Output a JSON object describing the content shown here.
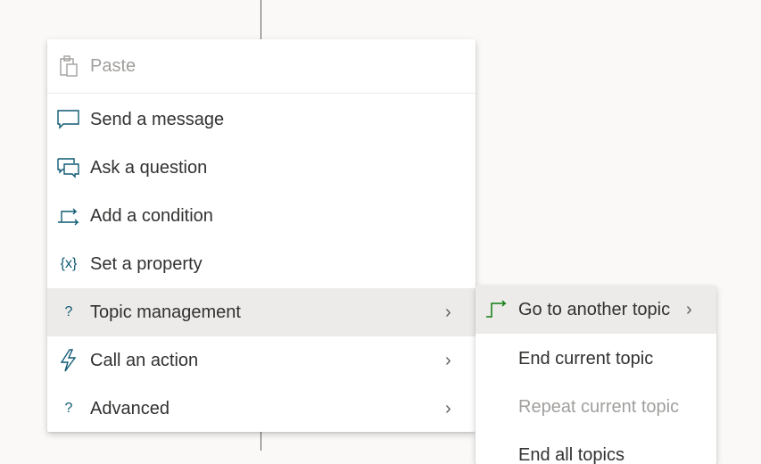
{
  "main_menu": {
    "paste": "Paste",
    "items": [
      {
        "label": "Send a message",
        "icon": "message-icon"
      },
      {
        "label": "Ask a question",
        "icon": "question-chat-icon"
      },
      {
        "label": "Add a condition",
        "icon": "condition-icon"
      },
      {
        "label": "Set a property",
        "icon": "variable-icon",
        "icon_text": "{x}"
      },
      {
        "label": "Topic management",
        "icon": "topic-icon",
        "icon_text": "?",
        "has_submenu": true
      },
      {
        "label": "Call an action",
        "icon": "lightning-icon",
        "has_submenu": true
      },
      {
        "label": "Advanced",
        "icon": "advanced-icon",
        "icon_text": "?",
        "has_submenu": true
      }
    ]
  },
  "submenu": {
    "items": [
      {
        "label": "Go to another topic",
        "has_submenu": true
      },
      {
        "label": "End current topic"
      },
      {
        "label": "Repeat current topic",
        "disabled": true
      },
      {
        "label": "End all topics"
      }
    ]
  },
  "colors": {
    "icon": "#0f5a73",
    "hover": "#edebe9",
    "goto_icon": "#107c10"
  }
}
